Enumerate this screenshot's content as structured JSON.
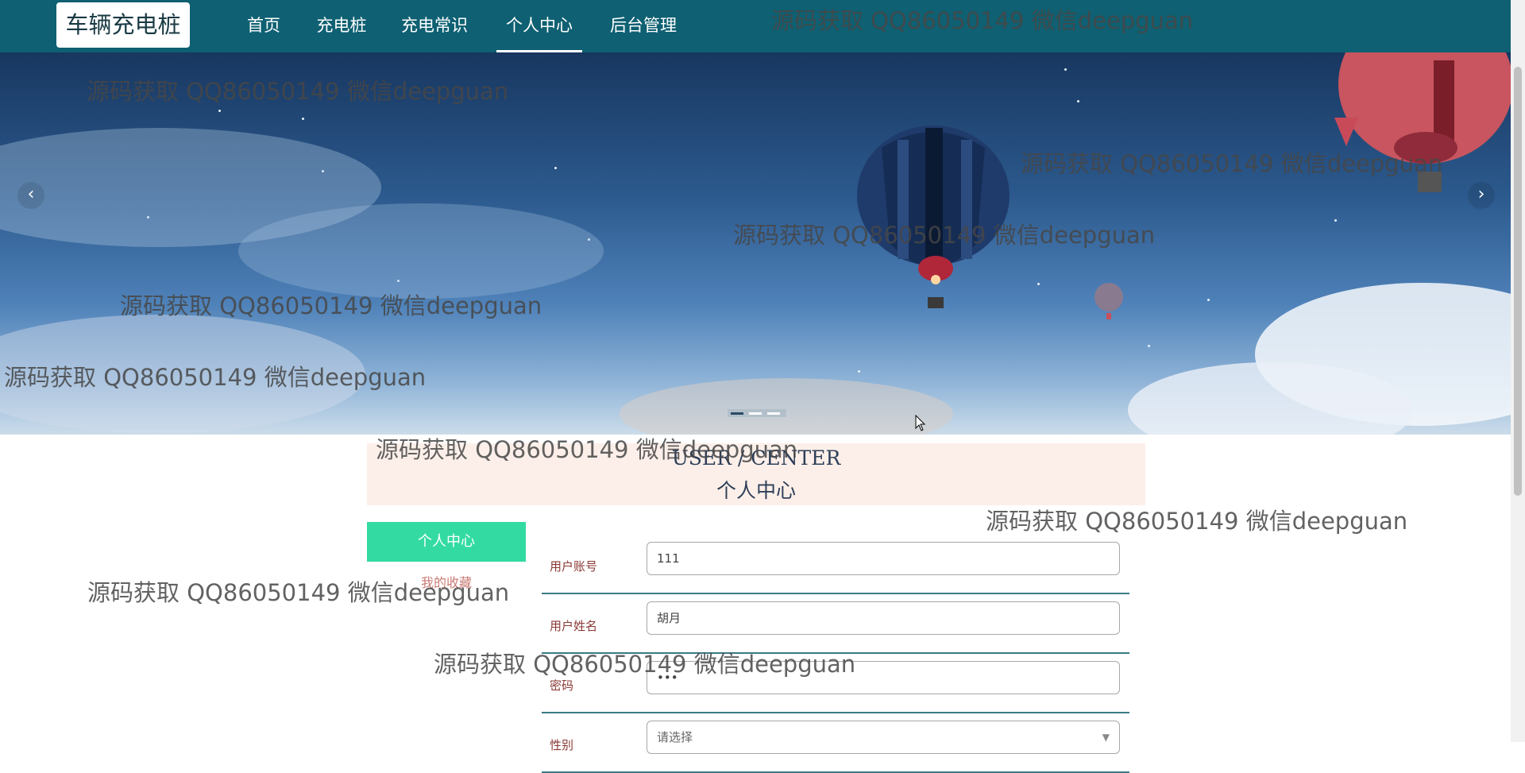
{
  "brand": "车辆充电桩",
  "nav": [
    {
      "label": "首页",
      "active": false
    },
    {
      "label": "充电桩",
      "active": false
    },
    {
      "label": "充电常识",
      "active": false
    },
    {
      "label": "个人中心",
      "active": true
    },
    {
      "label": "后台管理",
      "active": false
    }
  ],
  "banner": {
    "prev_icon": "chevron-left-icon",
    "next_icon": "chevron-right-icon",
    "prev_glyph": "‹",
    "next_glyph": "›",
    "slides": 3,
    "active_slide": 1
  },
  "watermark": "源码获取 QQ86050149 微信deepguan",
  "center": {
    "title_en": "USER / CENTER",
    "title_cn": "个人中心"
  },
  "sidebar": {
    "active_label": "个人中心",
    "link_label": "我的收藏"
  },
  "form": {
    "account_label": "用户账号",
    "account_value": "111",
    "name_label": "用户姓名",
    "name_value": "胡月",
    "password_label": "密码",
    "password_value": "111",
    "gender_label": "性别",
    "gender_value": "请选择"
  },
  "colors": {
    "nav_bg": "#0e6072",
    "accent_green": "#33dba3",
    "header_bg": "#fcefe9",
    "divider": "#3a7b86"
  }
}
